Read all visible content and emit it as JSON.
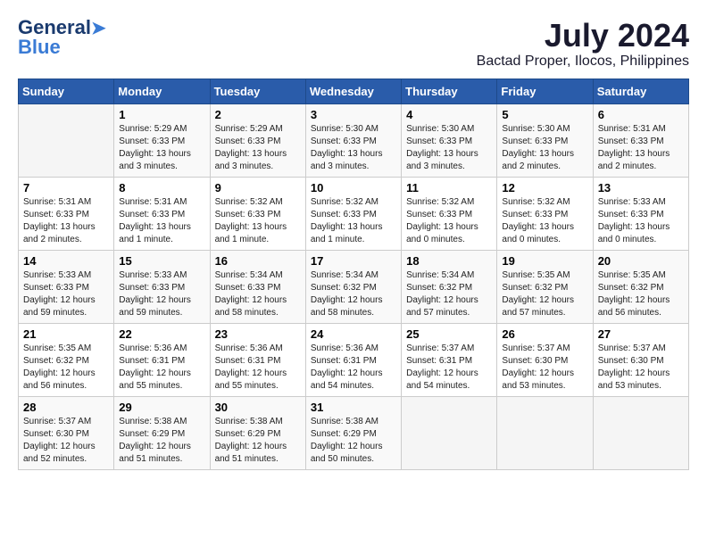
{
  "logo": {
    "line1": "General",
    "line2": "Blue"
  },
  "title": {
    "month_year": "July 2024",
    "location": "Bactad Proper, Ilocos, Philippines"
  },
  "headers": [
    "Sunday",
    "Monday",
    "Tuesday",
    "Wednesday",
    "Thursday",
    "Friday",
    "Saturday"
  ],
  "weeks": [
    [
      {
        "day": "",
        "info": ""
      },
      {
        "day": "1",
        "info": "Sunrise: 5:29 AM\nSunset: 6:33 PM\nDaylight: 13 hours\nand 3 minutes."
      },
      {
        "day": "2",
        "info": "Sunrise: 5:29 AM\nSunset: 6:33 PM\nDaylight: 13 hours\nand 3 minutes."
      },
      {
        "day": "3",
        "info": "Sunrise: 5:30 AM\nSunset: 6:33 PM\nDaylight: 13 hours\nand 3 minutes."
      },
      {
        "day": "4",
        "info": "Sunrise: 5:30 AM\nSunset: 6:33 PM\nDaylight: 13 hours\nand 3 minutes."
      },
      {
        "day": "5",
        "info": "Sunrise: 5:30 AM\nSunset: 6:33 PM\nDaylight: 13 hours\nand 2 minutes."
      },
      {
        "day": "6",
        "info": "Sunrise: 5:31 AM\nSunset: 6:33 PM\nDaylight: 13 hours\nand 2 minutes."
      }
    ],
    [
      {
        "day": "7",
        "info": "Sunrise: 5:31 AM\nSunset: 6:33 PM\nDaylight: 13 hours\nand 2 minutes."
      },
      {
        "day": "8",
        "info": "Sunrise: 5:31 AM\nSunset: 6:33 PM\nDaylight: 13 hours\nand 1 minute."
      },
      {
        "day": "9",
        "info": "Sunrise: 5:32 AM\nSunset: 6:33 PM\nDaylight: 13 hours\nand 1 minute."
      },
      {
        "day": "10",
        "info": "Sunrise: 5:32 AM\nSunset: 6:33 PM\nDaylight: 13 hours\nand 1 minute."
      },
      {
        "day": "11",
        "info": "Sunrise: 5:32 AM\nSunset: 6:33 PM\nDaylight: 13 hours\nand 0 minutes."
      },
      {
        "day": "12",
        "info": "Sunrise: 5:32 AM\nSunset: 6:33 PM\nDaylight: 13 hours\nand 0 minutes."
      },
      {
        "day": "13",
        "info": "Sunrise: 5:33 AM\nSunset: 6:33 PM\nDaylight: 13 hours\nand 0 minutes."
      }
    ],
    [
      {
        "day": "14",
        "info": "Sunrise: 5:33 AM\nSunset: 6:33 PM\nDaylight: 12 hours\nand 59 minutes."
      },
      {
        "day": "15",
        "info": "Sunrise: 5:33 AM\nSunset: 6:33 PM\nDaylight: 12 hours\nand 59 minutes."
      },
      {
        "day": "16",
        "info": "Sunrise: 5:34 AM\nSunset: 6:33 PM\nDaylight: 12 hours\nand 58 minutes."
      },
      {
        "day": "17",
        "info": "Sunrise: 5:34 AM\nSunset: 6:32 PM\nDaylight: 12 hours\nand 58 minutes."
      },
      {
        "day": "18",
        "info": "Sunrise: 5:34 AM\nSunset: 6:32 PM\nDaylight: 12 hours\nand 57 minutes."
      },
      {
        "day": "19",
        "info": "Sunrise: 5:35 AM\nSunset: 6:32 PM\nDaylight: 12 hours\nand 57 minutes."
      },
      {
        "day": "20",
        "info": "Sunrise: 5:35 AM\nSunset: 6:32 PM\nDaylight: 12 hours\nand 56 minutes."
      }
    ],
    [
      {
        "day": "21",
        "info": "Sunrise: 5:35 AM\nSunset: 6:32 PM\nDaylight: 12 hours\nand 56 minutes."
      },
      {
        "day": "22",
        "info": "Sunrise: 5:36 AM\nSunset: 6:31 PM\nDaylight: 12 hours\nand 55 minutes."
      },
      {
        "day": "23",
        "info": "Sunrise: 5:36 AM\nSunset: 6:31 PM\nDaylight: 12 hours\nand 55 minutes."
      },
      {
        "day": "24",
        "info": "Sunrise: 5:36 AM\nSunset: 6:31 PM\nDaylight: 12 hours\nand 54 minutes."
      },
      {
        "day": "25",
        "info": "Sunrise: 5:37 AM\nSunset: 6:31 PM\nDaylight: 12 hours\nand 54 minutes."
      },
      {
        "day": "26",
        "info": "Sunrise: 5:37 AM\nSunset: 6:30 PM\nDaylight: 12 hours\nand 53 minutes."
      },
      {
        "day": "27",
        "info": "Sunrise: 5:37 AM\nSunset: 6:30 PM\nDaylight: 12 hours\nand 53 minutes."
      }
    ],
    [
      {
        "day": "28",
        "info": "Sunrise: 5:37 AM\nSunset: 6:30 PM\nDaylight: 12 hours\nand 52 minutes."
      },
      {
        "day": "29",
        "info": "Sunrise: 5:38 AM\nSunset: 6:29 PM\nDaylight: 12 hours\nand 51 minutes."
      },
      {
        "day": "30",
        "info": "Sunrise: 5:38 AM\nSunset: 6:29 PM\nDaylight: 12 hours\nand 51 minutes."
      },
      {
        "day": "31",
        "info": "Sunrise: 5:38 AM\nSunset: 6:29 PM\nDaylight: 12 hours\nand 50 minutes."
      },
      {
        "day": "",
        "info": ""
      },
      {
        "day": "",
        "info": ""
      },
      {
        "day": "",
        "info": ""
      }
    ]
  ]
}
